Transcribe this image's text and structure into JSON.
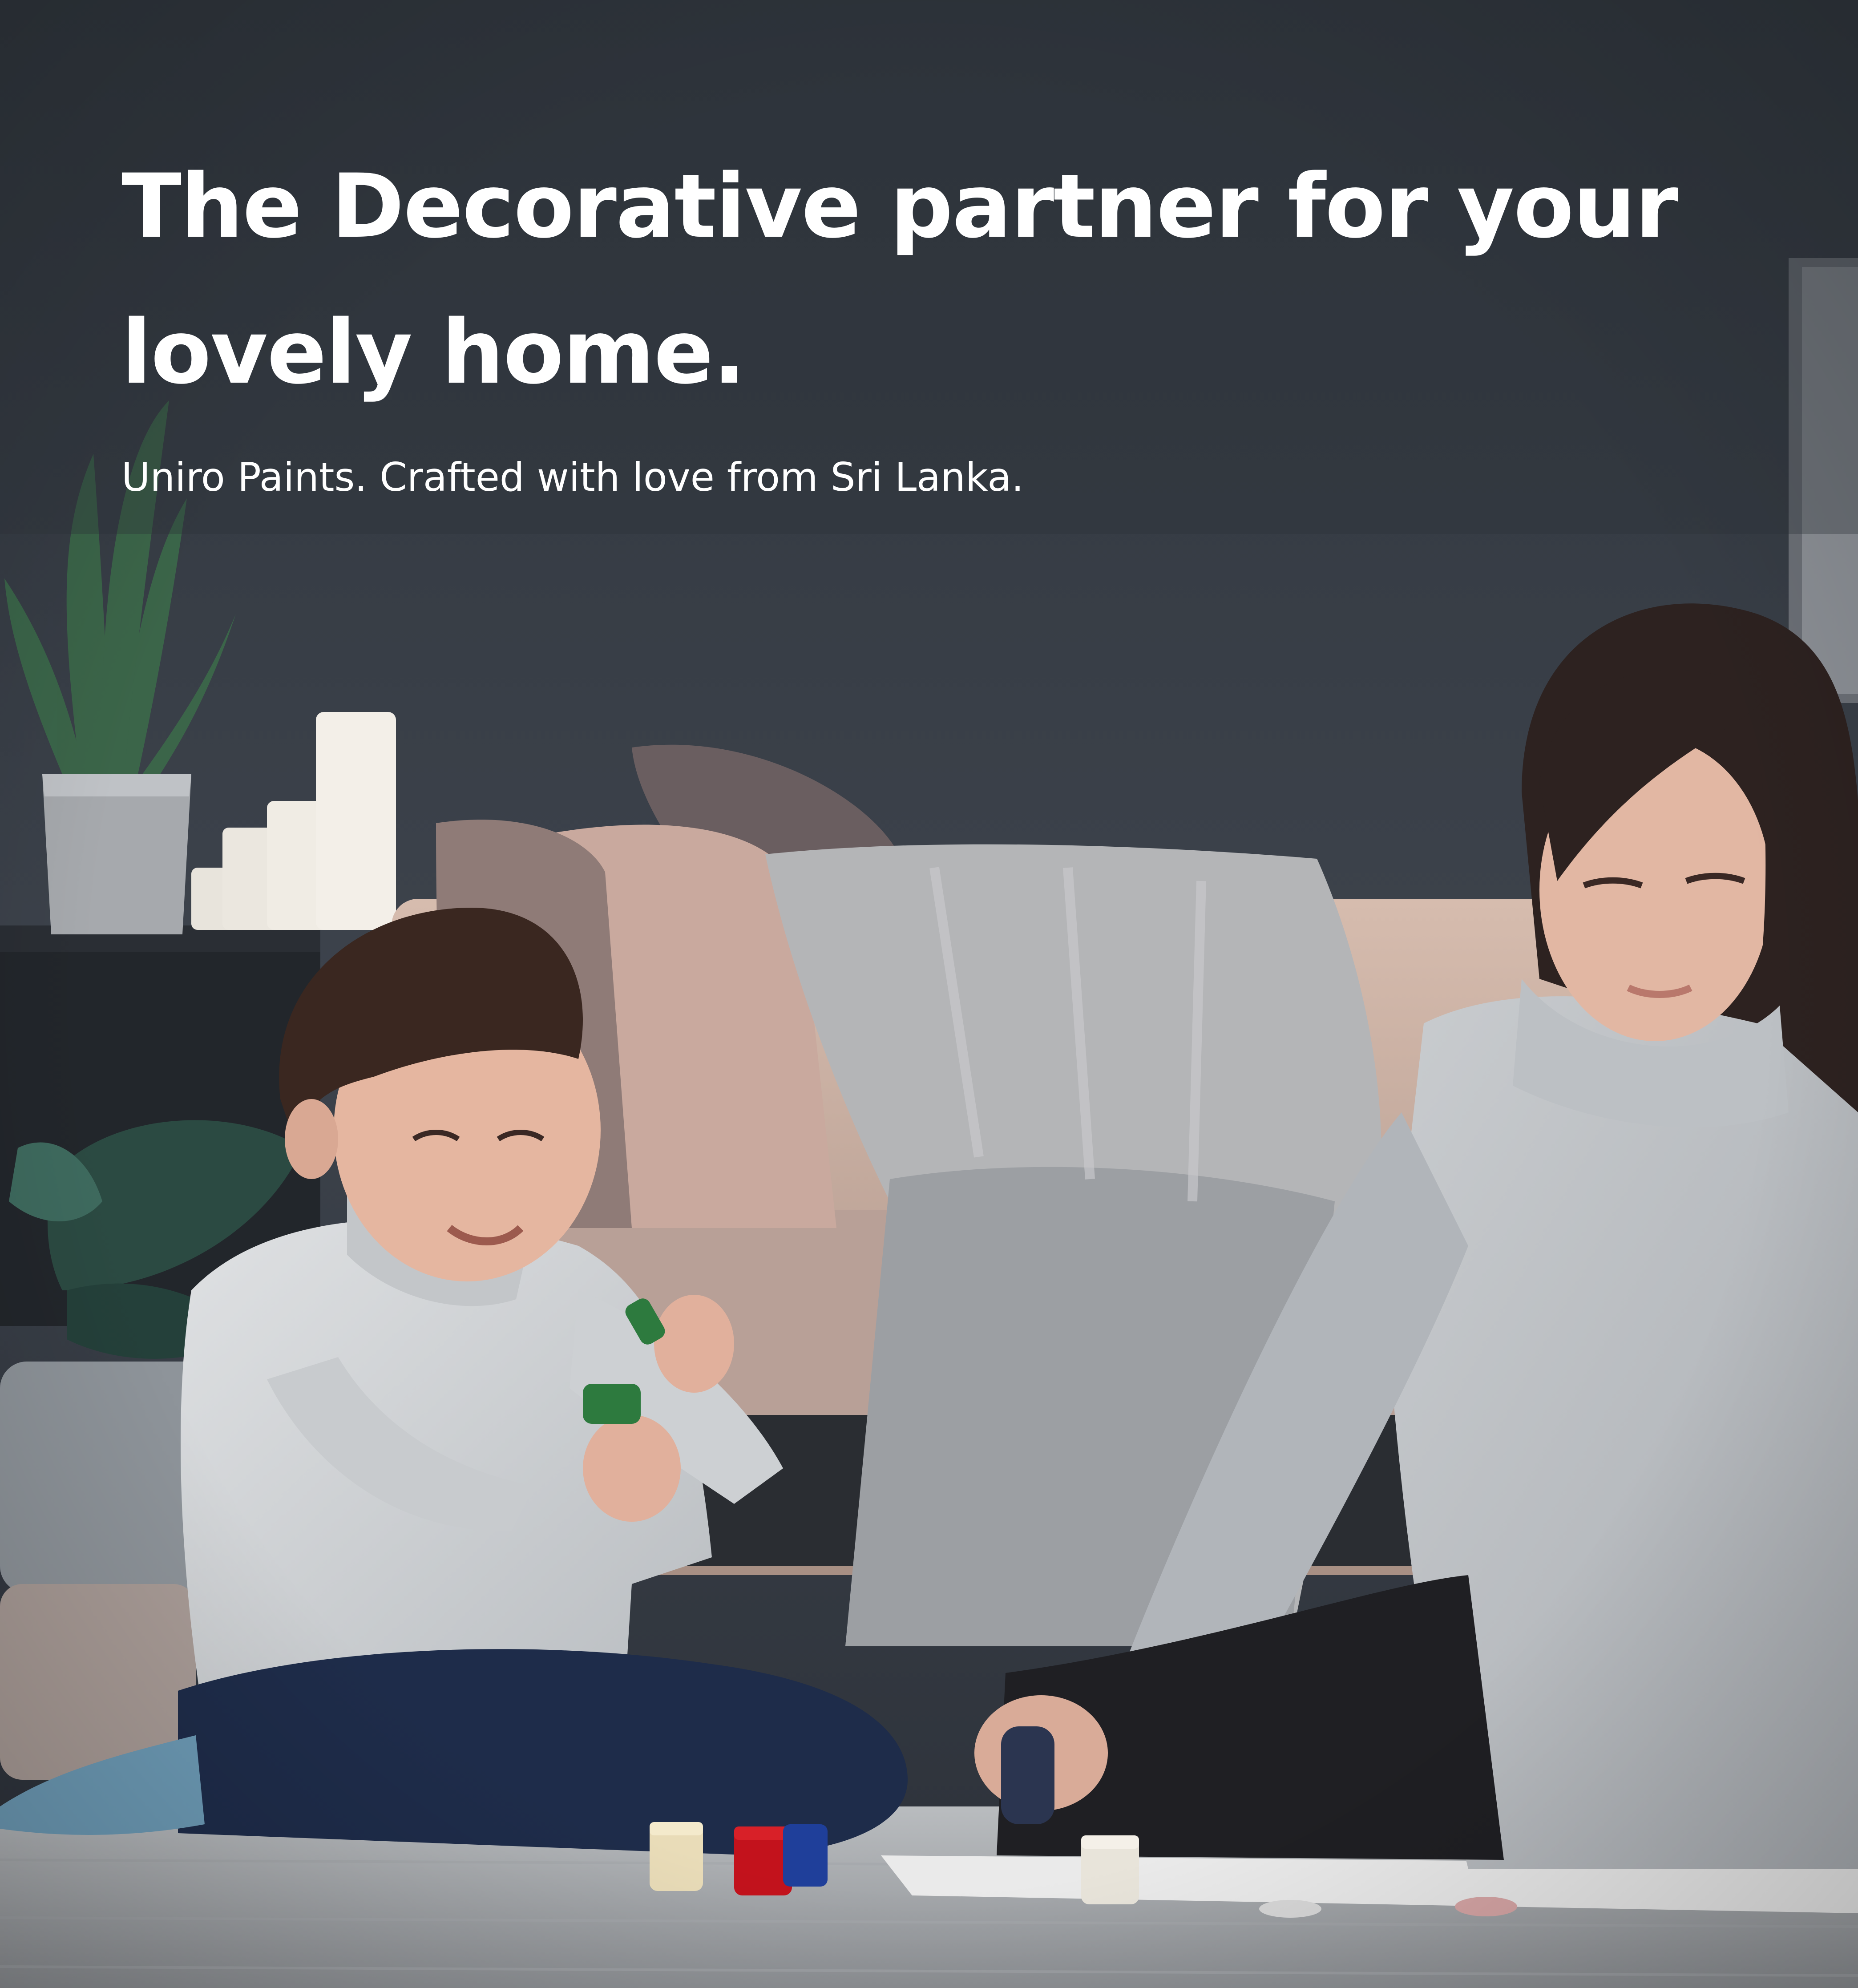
{
  "hero": {
    "headline": "The Decorative partner for your\nlovely home.",
    "subline": "Uniro Paints. Crafted with love from Sri Lanka."
  },
  "photo": {
    "description": "mother-and-child-painting-at-home"
  },
  "colors": {
    "wall": "#3a4048",
    "text": "#ffffff"
  }
}
